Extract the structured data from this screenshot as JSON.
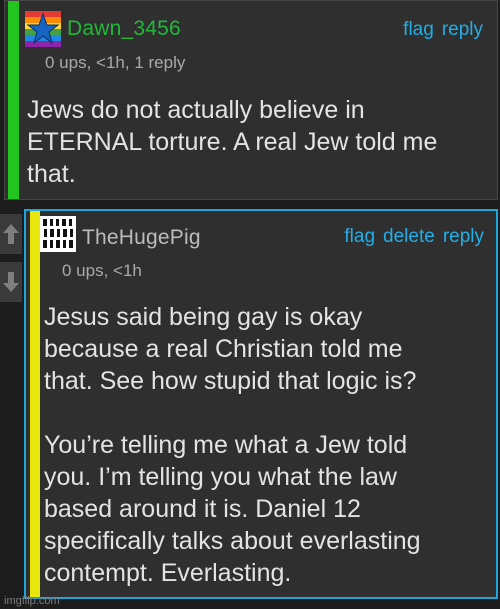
{
  "comments": [
    {
      "username": "Dawn_3456",
      "username_color": "#22b83a",
      "meta": "0 ups, <1h, 1 reply",
      "body": "Jews do not actually believe in\nETERNAL torture. A real Jew told me\nthat.",
      "actions": [
        "flag",
        "reply"
      ],
      "bar_color": "#22c51e"
    },
    {
      "username": "TheHugePig",
      "username_color": "#bcbcbc",
      "meta": "0 ups, <1h",
      "body": "Jesus said being gay is okay\nbecause a real Christian told me\nthat. See how stupid that logic is?\n\nYou’re telling me what a Jew told\nyou. I’m telling you what the law\nbased around it is. Daniel 12\nspecifically talks about everlasting\ncontempt. Everlasting.",
      "actions": [
        "flag",
        "delete",
        "reply"
      ],
      "bar_color": "#e8e80f"
    }
  ],
  "vote_icons": [
    "arrow-up-icon",
    "arrow-down-icon"
  ],
  "accent_color": "#22aee6",
  "watermark": "imgflip.com"
}
